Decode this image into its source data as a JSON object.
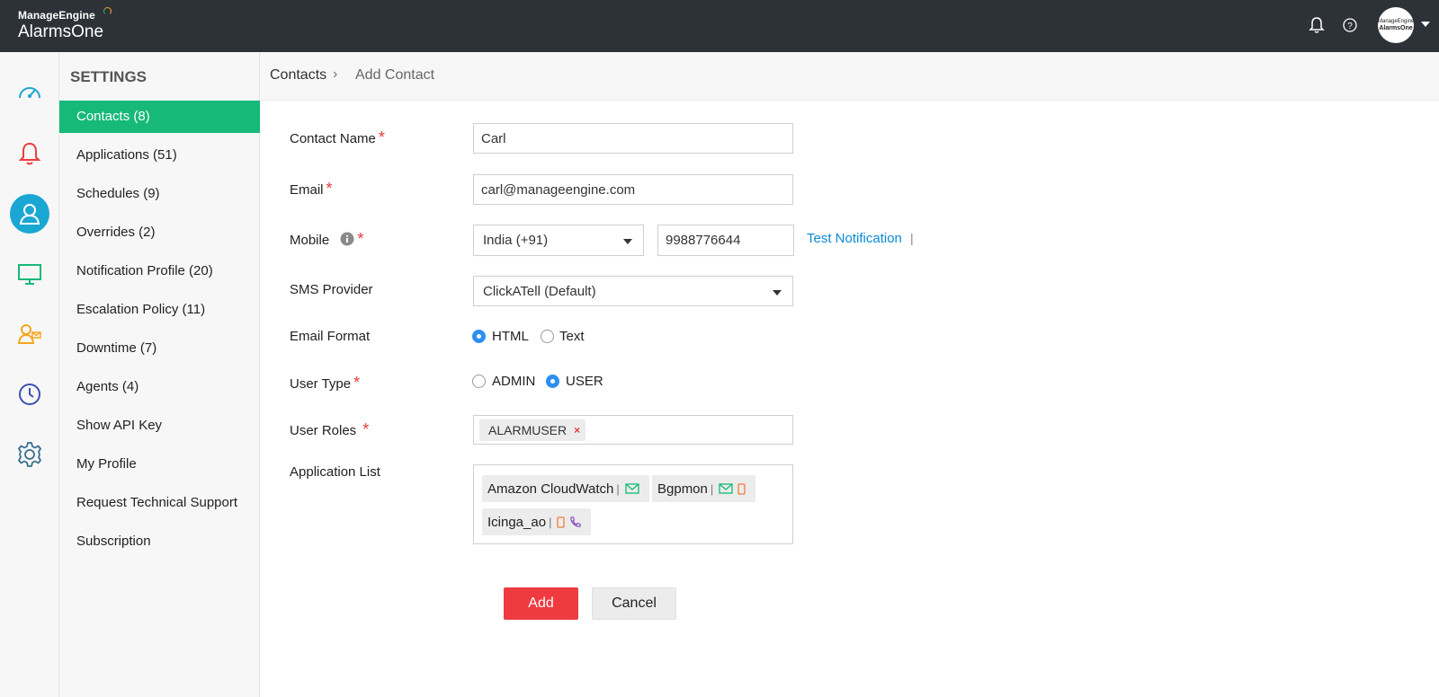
{
  "header": {
    "brand": "ManageEngine",
    "product": "AlarmsOne",
    "avatar_line1": "ManageEngine",
    "avatar_line2": "AlarmsOne"
  },
  "rail_icons": [
    "dashboard-icon",
    "alarm-bell-icon",
    "user-icon",
    "monitor-icon",
    "users-icon",
    "clock-icon",
    "gear-icon"
  ],
  "sidebar": {
    "title": "SETTINGS",
    "items": [
      {
        "label": "Contacts (8)",
        "active": true
      },
      {
        "label": "Applications (51)"
      },
      {
        "label": "Schedules (9)"
      },
      {
        "label": "Overrides (2)"
      },
      {
        "label": "Notification Profile (20)"
      },
      {
        "label": "Escalation Policy (11)"
      },
      {
        "label": "Downtime (7)"
      },
      {
        "label": "Agents (4)"
      },
      {
        "label": "Show API Key"
      },
      {
        "label": "My Profile"
      },
      {
        "label": "Request Technical Support"
      },
      {
        "label": "Subscription"
      }
    ]
  },
  "breadcrumb": {
    "parent": "Contacts",
    "separator": "›",
    "current": "Add Contact"
  },
  "form": {
    "contact_name": {
      "label": "Contact Name",
      "value": "Carl"
    },
    "email": {
      "label": "Email",
      "value": "carl@manageengine.com"
    },
    "mobile": {
      "label": "Mobile",
      "country": "India (+91)",
      "number": "9988776644",
      "test_link": "Test Notification",
      "pipe": "|"
    },
    "sms_provider": {
      "label": "SMS Provider",
      "value": "ClickATell (Default)"
    },
    "email_format": {
      "label": "Email Format",
      "options": [
        "HTML",
        "Text"
      ],
      "selected": "HTML"
    },
    "user_type": {
      "label": "User Type",
      "options": [
        "ADMIN",
        "USER"
      ],
      "selected": "USER"
    },
    "user_roles": {
      "label": "User Roles",
      "tags": [
        "ALARMUSER"
      ],
      "remove": "×"
    },
    "application_list": {
      "label": "Application List",
      "apps": [
        {
          "name": "Amazon CloudWatch",
          "icons": [
            "email-icon"
          ]
        },
        {
          "name": "Bgpmon",
          "icons": [
            "email-icon",
            "mobile-icon"
          ]
        },
        {
          "name": "Icinga_ao",
          "icons": [
            "mobile-icon",
            "phone-icon"
          ]
        }
      ]
    },
    "required_mark": "*",
    "add_label": "Add",
    "cancel_label": "Cancel"
  },
  "colors": {
    "topbar": "#2d3239",
    "accent_green": "#17b978",
    "accent_blue": "#1ba7d3",
    "link": "#0a8ad4",
    "danger": "#ef3b40"
  }
}
